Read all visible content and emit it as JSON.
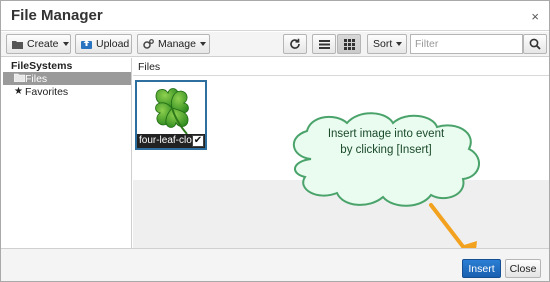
{
  "dialog": {
    "title": "File Manager",
    "close_glyph": "×"
  },
  "toolbar": {
    "create_label": "Create",
    "upload_label": "Upload",
    "manage_label": "Manage",
    "sort_label": "Sort",
    "filter_placeholder": "Filter",
    "refresh_icon": "refresh-icon",
    "list_view_icon": "list-view-icon",
    "grid_view_icon": "grid-view-icon",
    "search_icon": "search-icon"
  },
  "sidebar": {
    "root_label": "FileSystems",
    "items": [
      {
        "label": "Files",
        "icon": "folder-icon",
        "selected": true
      },
      {
        "label": "Favorites",
        "icon": "star-icon",
        "selected": false
      }
    ]
  },
  "main": {
    "breadcrumb": "Files",
    "files": [
      {
        "name": "four-leaf-clo",
        "checked": true,
        "icon": "clover-image"
      }
    ]
  },
  "callout": {
    "line1": "Insert image into event",
    "line2": "by clicking [Insert]",
    "colors": {
      "fill": "#eafbf0",
      "stroke": "#4aa36a",
      "arrow": "#f2a21e"
    }
  },
  "footer": {
    "insert_label": "Insert",
    "close_label": "Close"
  },
  "colors": {
    "accent": "#1a6fc4",
    "selected_row": "#9a9a9a"
  }
}
